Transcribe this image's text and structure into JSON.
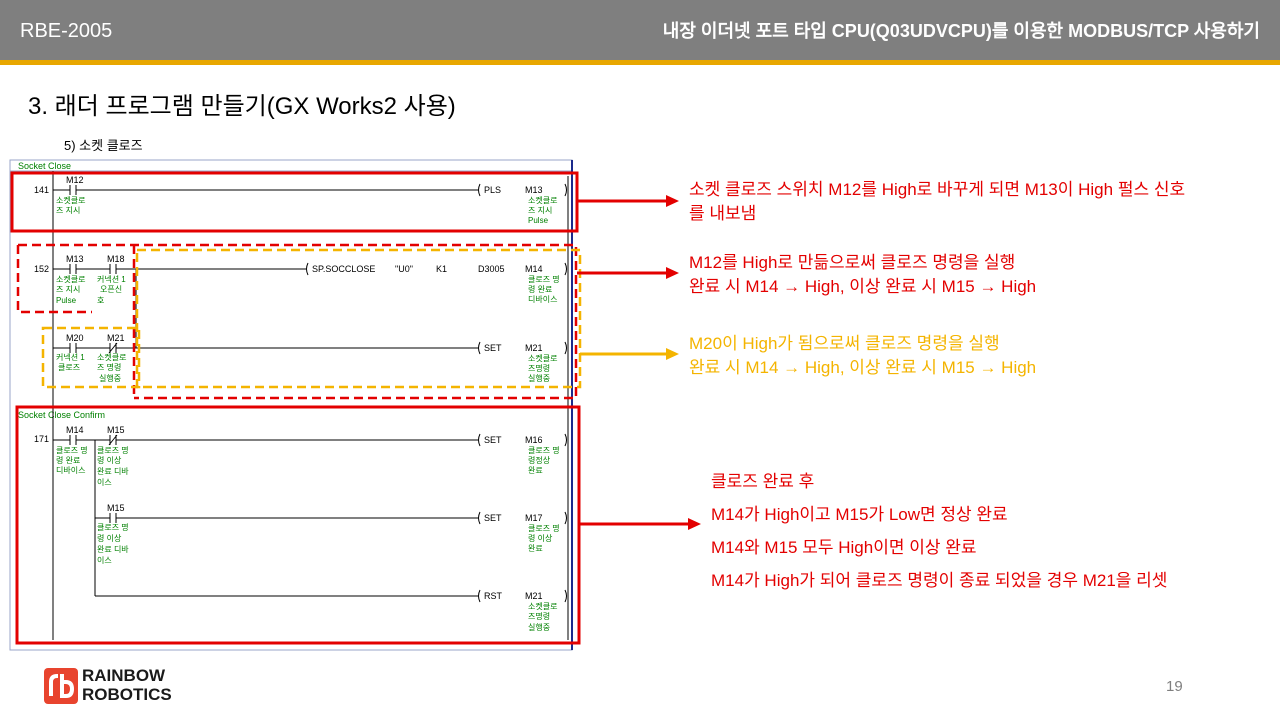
{
  "header": {
    "doc_code": "RBE-2005",
    "doc_title": "내장 이더넷 포트 타입 CPU(Q03UDVCPU)를 이용한 MODBUS/TCP 사용하기"
  },
  "section_title": "3. 래더 프로그램 만들기(GX Works2 사용)",
  "sub_title": "5) 소켓 클로즈",
  "ladder": {
    "block1_label": "Socket Close",
    "block2_label": "Socket Close Confirm",
    "step_141": "141",
    "step_152": "152",
    "step_171": "171",
    "c_m12": "M12",
    "c_m12_c1": "소켓클로",
    "c_m12_c2": "즈 지시",
    "i_pls": "PLS",
    "o_m13": "M13",
    "o_m13_c1": "소켓클로",
    "o_m13_c2": "즈 지시",
    "o_m13_c3": "Pulse",
    "c_m13": "M13",
    "c_m13_c1": "소켓클로",
    "c_m13_c2": "즈 지시",
    "c_m13_c3": "Pulse",
    "c_m18": "M18",
    "c_m18_c1": "커넥션 1",
    "c_m18_c2": "오픈신",
    "c_m18_c3": "호",
    "i_socclose": "SP.SOCCLOSE",
    "i_u0": "\"U0\"",
    "i_k1": "K1",
    "i_d3005": "D3005",
    "o_m14": "M14",
    "o_m14_c1": "클로즈 명",
    "o_m14_c2": "령 완료",
    "o_m14_c3": "디바이스",
    "c_m20": "M20",
    "c_m20_c1": "커넥션 1",
    "c_m20_c2": "클로즈",
    "c_m21": "M21",
    "c_m21_c1": "소켓클로",
    "c_m21_c2": "즈 명령",
    "c_m21_c3": "실행중",
    "i_set1": "SET",
    "o_m21": "M21",
    "o_m21_c1": "소켓클로",
    "o_m21_c2": "즈명령",
    "o_m21_c3": "실행중",
    "c_m14b": "M14",
    "c_m14b_c1": "클로즈 명",
    "c_m14b_c2": "령 완료",
    "c_m14b_c3": "디바이스",
    "c_m15": "M15",
    "c_m15_c1": "클로즈 명",
    "c_m15_c2": "령 이상",
    "c_m15_c3": "완료 디바",
    "c_m15_c4": "이스",
    "i_set2": "SET",
    "o_m16": "M16",
    "o_m16_c1": "클로즈 명",
    "o_m16_c2": "령정상",
    "o_m16_c3": "완료",
    "c_m15b": "M15",
    "c_m15b_c1": "클로즈 명",
    "c_m15b_c2": "령 이상",
    "c_m15b_c3": "완료 디바",
    "c_m15b_c4": "이스",
    "i_set3": "SET",
    "o_m17": "M17",
    "o_m17_c1": "클로즈 명",
    "o_m17_c2": "령 이상",
    "o_m17_c3": "완료",
    "i_rst": "RST",
    "o_m21b": "M21",
    "o_m21b_c1": "소켓클로",
    "o_m21b_c2": "즈명령",
    "o_m21b_c3": "실행중"
  },
  "notes": {
    "n1_line1": "소켓 클로즈 스위치 M12를 High로 바꾸게 되면 M13이 High 펄스 신호",
    "n1_line2": "를 내보냄",
    "n2_line1": "M12를 High로 만듦으로써 클로즈 명령을 실행",
    "n2_line2": "완료 시 M14 → High, 이상 완료 시 M15 → High",
    "n3_line1": "M20이 High가 됨으로써 클로즈 명령을 실행",
    "n3_line2": "완료 시 M14 → High, 이상 완료 시 M15 → High",
    "n4_line1": "클로즈 완료 후",
    "n4_line2": "M14가 High이고 M15가 Low면 정상 완료",
    "n4_line3": "M14와 M15 모두 High이면 이상 완료",
    "n4_line4": "M14가 High가 되어 클로즈 명령이 종료 되었을 경우 M21을 리셋"
  },
  "footer": {
    "logo_line1": "RAINBOW",
    "logo_line2": "ROBOTICS",
    "page_number": "19"
  },
  "colors": {
    "header_bg": "#7f7f7f",
    "accent_bar": "#e8a700",
    "highlight_red": "#e30000",
    "highlight_orange": "#f4b400",
    "comment_green": "#008000"
  }
}
